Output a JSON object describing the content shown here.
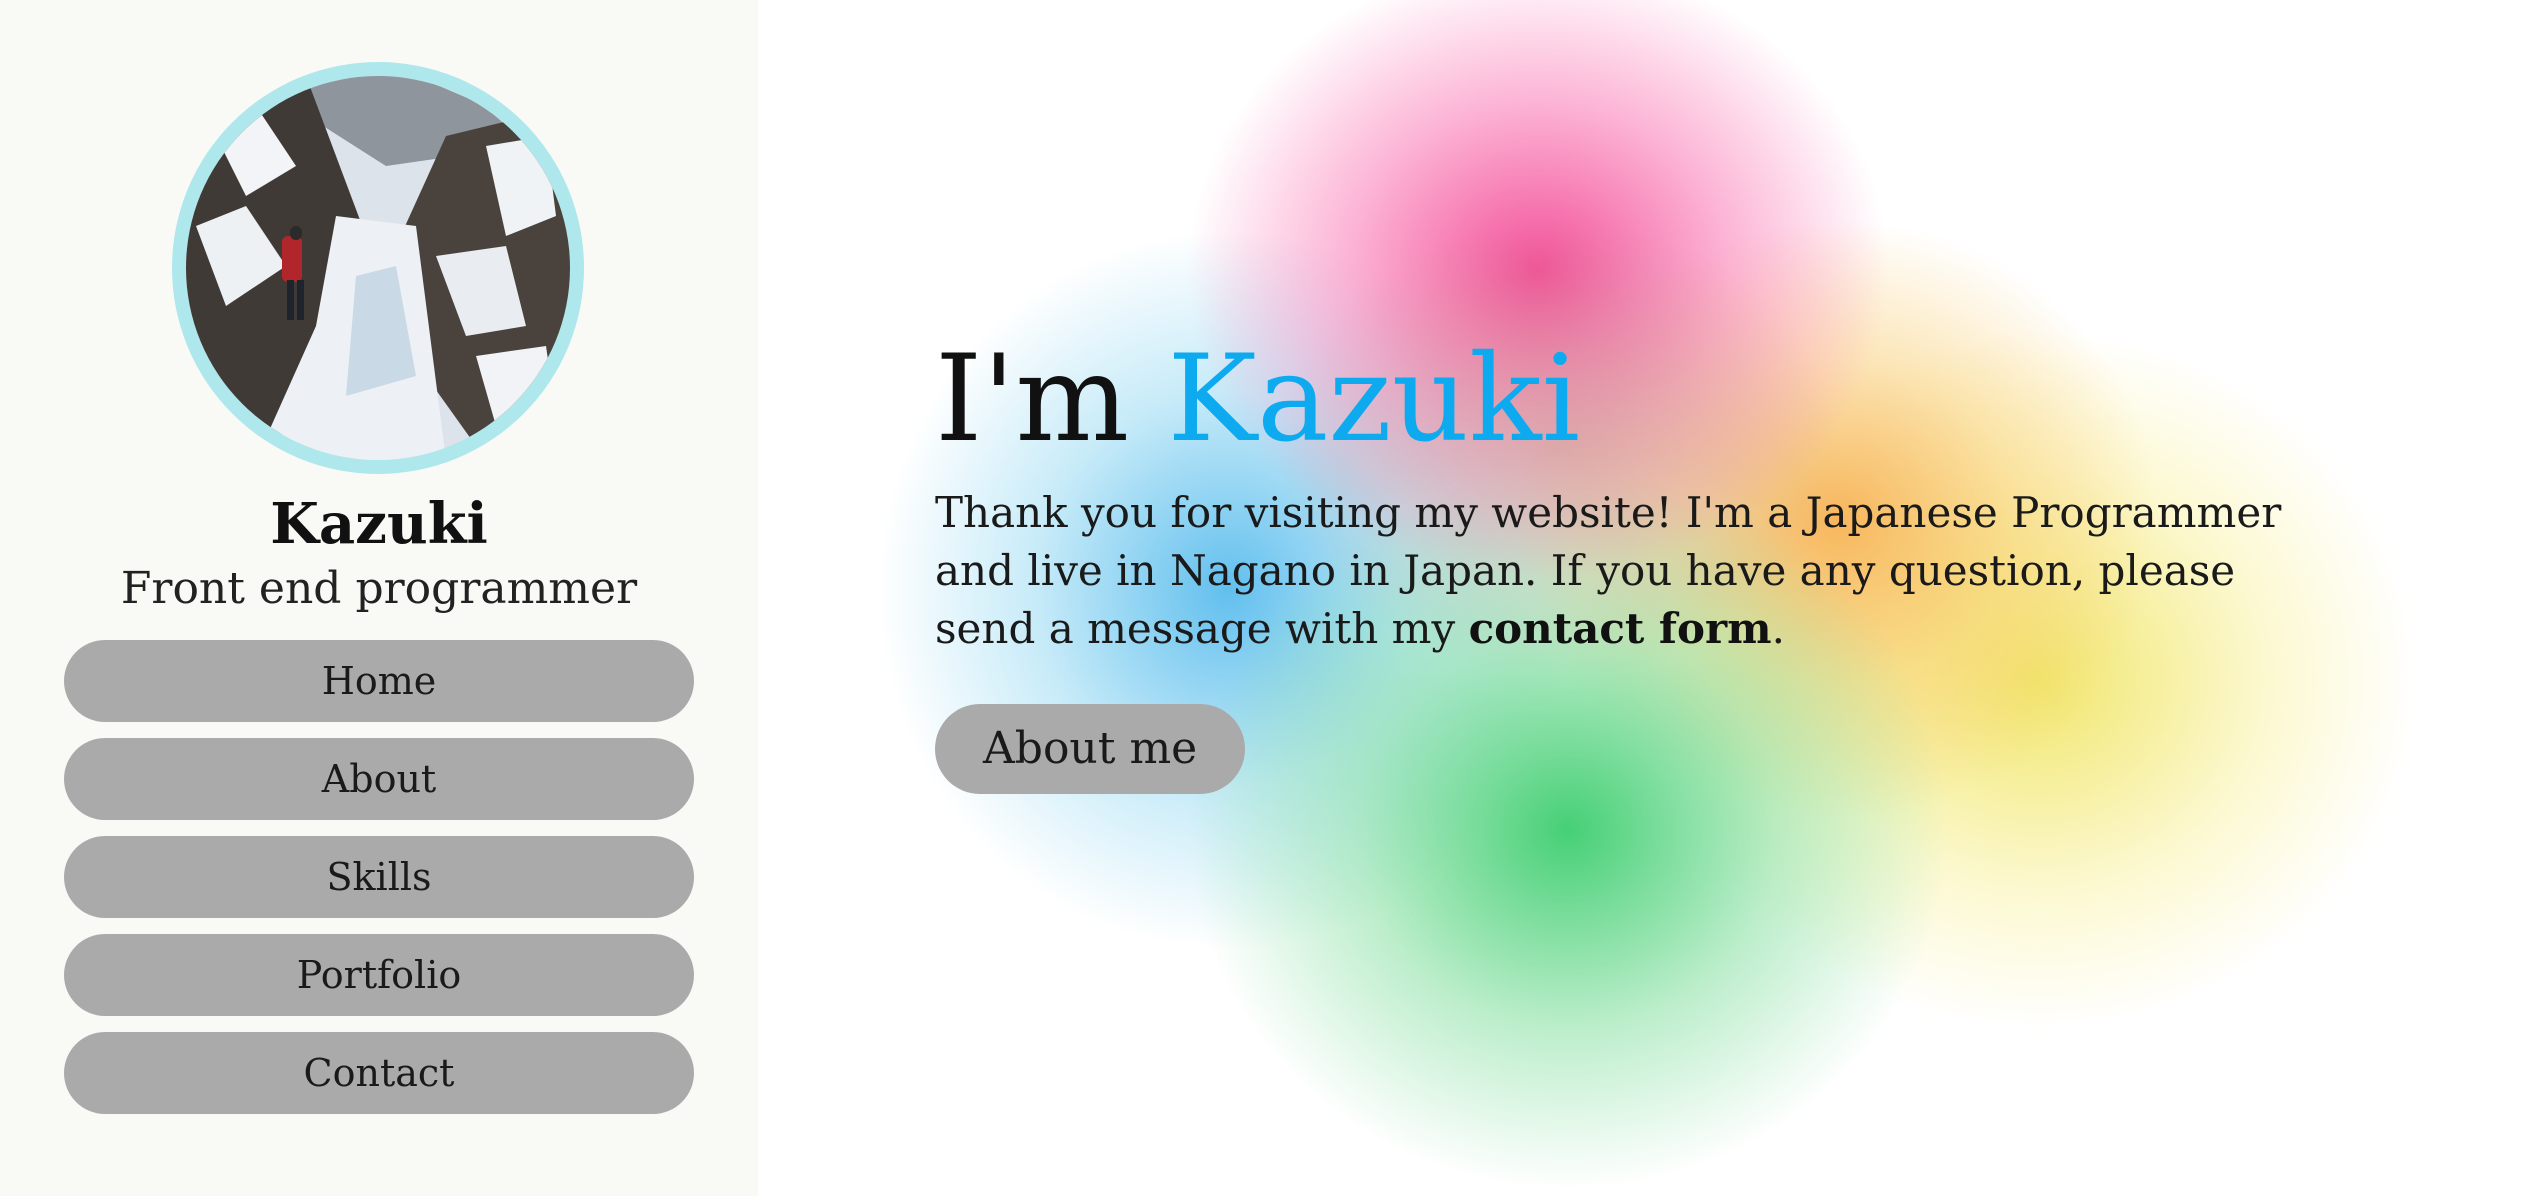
{
  "sidebar": {
    "profile_name": "Kazuki",
    "profile_role": "Front end programmer",
    "nav": [
      {
        "label": "Home"
      },
      {
        "label": "About"
      },
      {
        "label": "Skills"
      },
      {
        "label": "Portfolio"
      },
      {
        "label": "Contact"
      }
    ]
  },
  "hero": {
    "title_prefix": "I'm ",
    "title_name": "Kazuki",
    "intro": "Thank you for visiting my website! I'm a Japanese Programmer and live in Nagano in Japan. If you have any question, please send a message with my ",
    "contact_link": "contact form",
    "intro_end": ".",
    "button_label": "About me"
  },
  "colors": {
    "sidebar_bg": "#f9f9f6",
    "avatar_ring": "#aee8ec",
    "button_bg": "#aaaaaa",
    "accent": "#0eaaf0"
  }
}
